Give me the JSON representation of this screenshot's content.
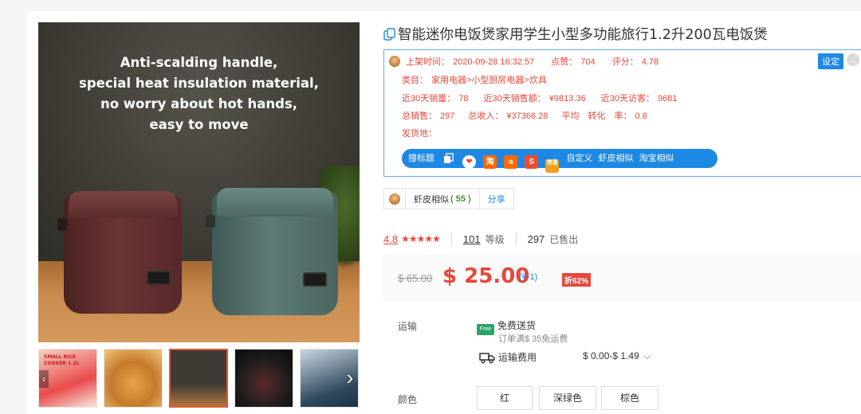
{
  "product": {
    "title": "智能迷你电饭煲家用学生小型多功能旅行1.2升200瓦电饭煲",
    "image_caption_lines": [
      "Anti-scalding handle,",
      "special heat insulation material,",
      "no worry about hot hands,",
      "easy to move"
    ],
    "thumbnails": [
      {
        "label": "SMALL RICE COOKER 1.2L"
      },
      {
        "label": ""
      },
      {
        "label": ""
      },
      {
        "label": ""
      },
      {
        "label": ""
      }
    ]
  },
  "plugin": {
    "listed_label": "上架时间：",
    "listed_value": "2020-09-28 16:32:57",
    "likes_label": "点赞：",
    "likes_value": "704",
    "score_label": "评分：",
    "score_value": "4.78",
    "category_label": "类目：",
    "category_value": "家用电器>小型厨房电器>炊具",
    "sales30_label": "近30天销量：",
    "sales30_value": "78",
    "revenue30_label": "近30天销售额：",
    "revenue30_value": "¥9813.36",
    "visitors30_label": "近30天访客：",
    "visitors30_value": "9681",
    "total_sales_label": "总销售：",
    "total_sales_value": "297",
    "total_income_label": "总收入：",
    "total_income_value": "¥37366.28",
    "avg_conv_label": "平均　转化　率：",
    "avg_conv_value": "0.8",
    "ship_from_label": "发货地：",
    "settings_label": "设定",
    "toolbar": {
      "search_label": "搜标题",
      "custom_label": "自定义",
      "shopee_similar_label": "虾皮相似",
      "taobao_similar_label": "淘宝相似"
    }
  },
  "similar": {
    "label": "虾皮相似",
    "count": "55",
    "share_label": "分享"
  },
  "rating": {
    "value": "4.8",
    "stars": 5,
    "level_number": "101",
    "level_label": "等级",
    "sold_number": "297",
    "sold_label": "已售出"
  },
  "price": {
    "original": "$ 65.00",
    "current": "$ 25.00",
    "diff": "(¥-1)",
    "discount": "折62%"
  },
  "shipping": {
    "label": "运输",
    "free_label": "免费送货",
    "free_icon_text": "Free",
    "free_sub": "订单满$ 35免运费",
    "fee_label": "运输费用",
    "fee_range": "$ 0.00-$ 1.49"
  },
  "color": {
    "label": "颜色",
    "options": [
      "红",
      "深绿色",
      "棕色"
    ]
  },
  "colors": {
    "accent_blue": "#1e88e5",
    "price_red": "#e8473b"
  }
}
